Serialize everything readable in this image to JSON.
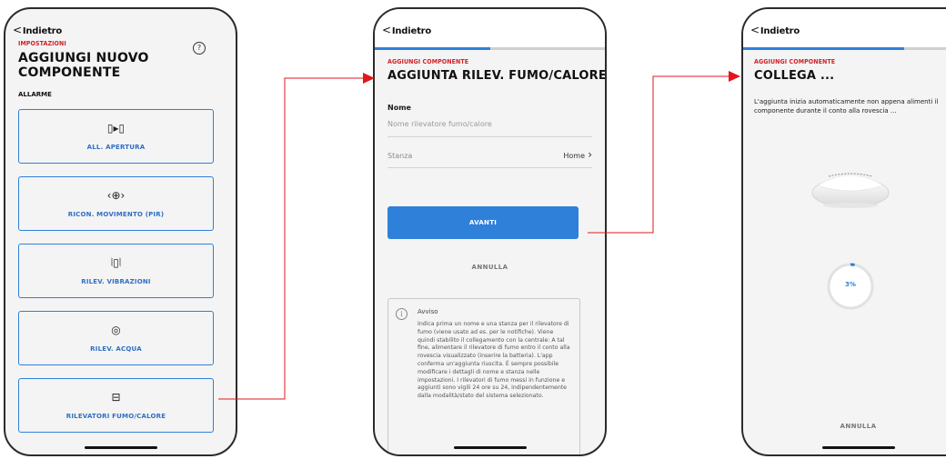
{
  "screen1": {
    "back_label": "Indietro",
    "eyebrow": "IMPOSTAZIONI",
    "title": "AGGIUNGI NUOVO COMPONENTE",
    "help_glyph": "?",
    "section": "ALLARME",
    "tiles": [
      {
        "label": "ALL. APERTURA",
        "icon": "door-contact-icon",
        "glyph": "▯▸▯"
      },
      {
        "label": "RICON. MOVIMENTO (PIR)",
        "icon": "motion-sensor-icon",
        "glyph": "‹⊕›"
      },
      {
        "label": "RILEV. VIBRAZIONI",
        "icon": "vibration-sensor-icon",
        "glyph": "⦚▯⦚"
      },
      {
        "label": "RILEV. ACQUA",
        "icon": "water-sensor-icon",
        "glyph": "◎"
      },
      {
        "label": "RILEVATORI FUMO/CALORE",
        "icon": "smoke-detector-icon",
        "glyph": "⊟"
      }
    ]
  },
  "screen2": {
    "back_label": "Indietro",
    "progress": 0.5,
    "eyebrow": "AGGIUNGI COMPONENTE",
    "title": "AGGIUNTA RILEV. FUMO/CALORE",
    "name_label": "Nome",
    "name_placeholder": "Nome rilevatore fumo/calore",
    "room_label": "Stanza",
    "room_value": "Home",
    "next_button": "AVANTI",
    "cancel_button": "ANNULLA",
    "notice_title": "Avviso",
    "notice_text": "Indica prima un nome e una stanza per il rilevatore di fumo (viene usato ad es. per le notifiche). Viene quindi stabilito il collegamento con la centrale: A tal fine, alimentare il rilevatore di fumo entro il conto alla rovescia visualizzato (inserire la batteria). L'app conferma un'aggiunta riuscita. È sempre possibile modificare i dettagli di nome e stanza nelle impostazioni. I rilevatori di fumo messi in funzione e aggiunti sono vigili 24 ore su 24, indipendentemente dalla modalità/stato del sistema selezionato."
  },
  "screen3": {
    "back_label": "Indietro",
    "progress": 0.7,
    "eyebrow": "AGGIUNGI COMPONENTE",
    "title": "COLLEGA ...",
    "description": "L'aggiunta inizia automaticamente non appena alimenti il componente durante il conto alla rovescia ...",
    "countdown_percent": 3,
    "countdown_label": "3%",
    "cancel_button": "ANNULLA"
  },
  "colors": {
    "accent_blue": "#2f80d9",
    "brand_red": "#d32027",
    "arrow_red": "#e2171c"
  }
}
